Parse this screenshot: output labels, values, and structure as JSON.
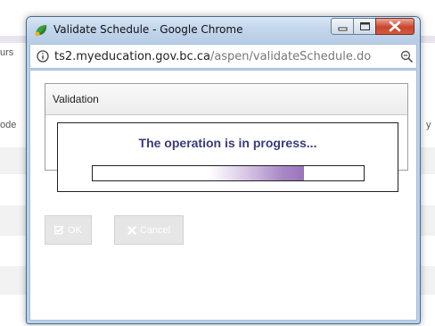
{
  "background": {
    "left_text_1": "urs",
    "left_text_2": "ode",
    "right_text": "y"
  },
  "window": {
    "title": "Validate Schedule - Google Chrome",
    "url_host": "ts2.myeducation.gov.bc.ca",
    "url_path": "/aspen/validateSchedule.do"
  },
  "validation": {
    "header": "Validation",
    "ok_label": "OK",
    "cancel_label": "Cancel"
  },
  "progress": {
    "message": "The operation is in progress...",
    "fraction": 0.78
  },
  "colors": {
    "progress_text": "#3b3b7a",
    "progress_fill": "#9a74bd"
  },
  "icons": {
    "app": "chrome-logo-icon",
    "info": "info-icon",
    "zoom": "zoom-out-icon",
    "ok": "check-square-icon",
    "cancel": "x-icon"
  }
}
